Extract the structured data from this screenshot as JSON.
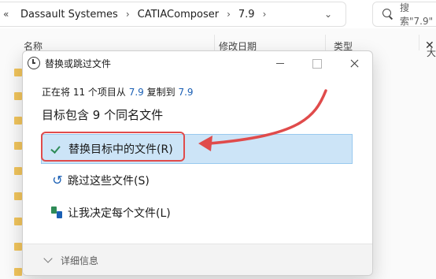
{
  "explorer": {
    "nav_prefix": "«",
    "breadcrumbs": [
      "Dassault Systemes",
      "CATIAComposer",
      "7.9"
    ],
    "breadcrumb_sep": "›",
    "search_placeholder": "搜索\"7.9\"",
    "columns": {
      "name": "名称",
      "modified": "修改日期",
      "type": "类型",
      "size": "大"
    },
    "side_close": "✕"
  },
  "dialog": {
    "title": "替换或跳过文件",
    "status": {
      "prefix": "正在将 11 个项目从 ",
      "from": "7.9",
      "middle": " 复制到 ",
      "to": "7.9"
    },
    "heading": "目标包含 9 个同名文件",
    "options": {
      "replace": "替换目标中的文件(R)",
      "skip": "跳过这些文件(S)",
      "decide": "让我决定每个文件(L)"
    },
    "footer": {
      "details": "详细信息"
    }
  },
  "colors": {
    "highlight": "#e04b4b",
    "selected_bg": "#cce4f7",
    "link": "#1a5fb4",
    "check": "#2e8b57"
  }
}
